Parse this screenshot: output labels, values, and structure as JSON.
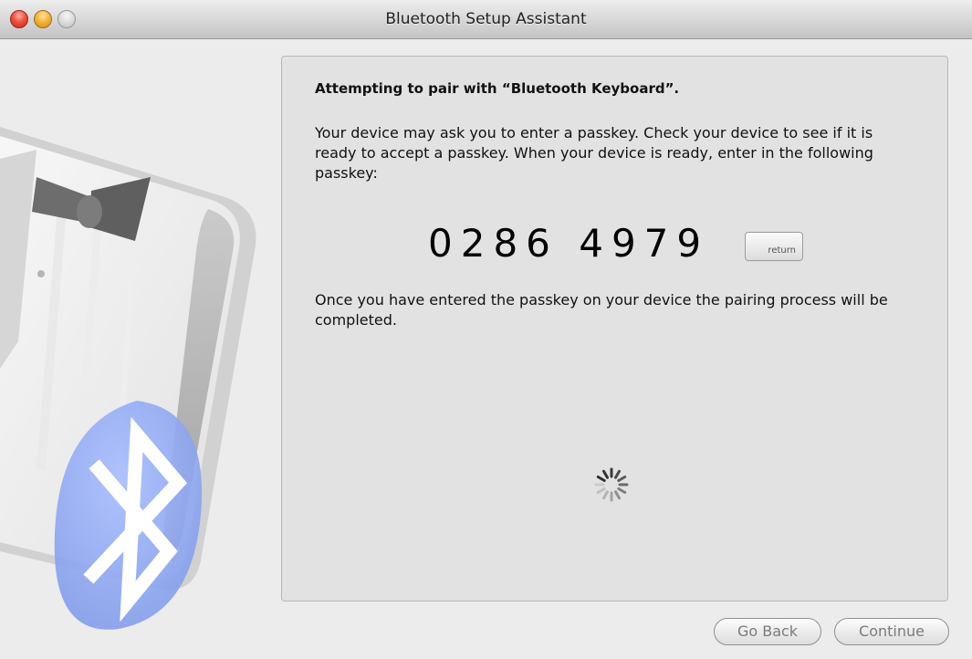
{
  "window": {
    "title": "Bluetooth Setup Assistant"
  },
  "content": {
    "heading": "Attempting to pair with “Bluetooth Keyboard”.",
    "instructions": "Your device may ask you to enter a passkey. Check your device to see if it is ready to accept a passkey. When your device is ready, enter in the following passkey:",
    "passkey": "0286 4979",
    "return_key_label": "return",
    "completion_note": "Once you have entered the passkey on your device the pairing process will be completed."
  },
  "buttons": {
    "go_back": "Go Back",
    "continue": "Continue"
  },
  "icons": {
    "close": "close-button",
    "minimize": "minimize-button",
    "zoom": "zoom-button",
    "spinner": "progress-spinner-icon",
    "bluetooth": "bluetooth-icon"
  },
  "colors": {
    "bluetooth_blue": "#8aa6ee",
    "close": "#f0503c",
    "minimize": "#f5b43a"
  }
}
